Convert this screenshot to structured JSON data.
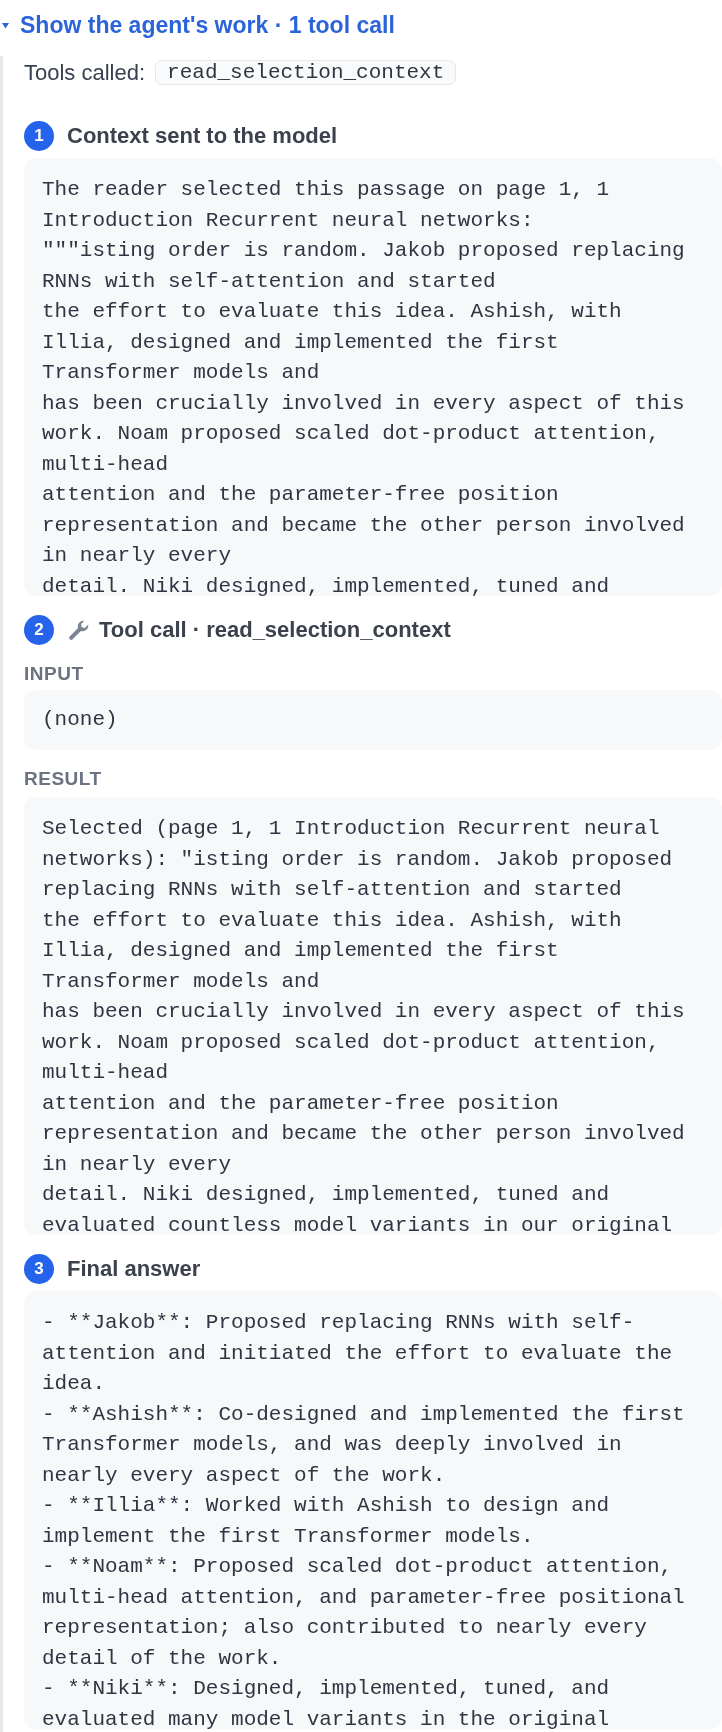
{
  "disclosure": {
    "label": "Show the agent's work · 1 tool call",
    "expanded": true
  },
  "tools_called": {
    "label": "Tools called:",
    "tools": [
      "read_selection_context"
    ]
  },
  "steps": [
    {
      "number": "1",
      "kind": "text",
      "title": "Context sent to the model",
      "text": "The reader selected this passage on page 1, 1\nIntroduction Recurrent neural networks:\n\"\"\"isting order is random. Jakob proposed replacing\nRNNs with self-attention and started\nthe effort to evaluate this idea. Ashish, with\nIllia, designed and implemented the first\nTransformer models and\nhas been crucially involved in every aspect of this\nwork. Noam proposed scaled dot-product attention,\nmulti-head\nattention and the parameter-free position\nrepresentation and became the other person involved\nin nearly every\ndetail. Niki designed, implemented, tuned and"
    },
    {
      "number": "2",
      "kind": "tool",
      "title": "Tool call · **read_selection_context**",
      "sections": [
        {
          "label": "INPUT",
          "text": "(none)"
        },
        {
          "label": "RESULT",
          "text": "Selected (page 1, 1 Introduction Recurrent neural\nnetworks): \"isting order is random. Jakob proposed\nreplacing RNNs with self-attention and started\nthe effort to evaluate this idea. Ashish, with\nIllia, designed and implemented the first\nTransformer models and\nhas been crucially involved in every aspect of this\nwork. Noam proposed scaled dot-product attention,\nmulti-head\nattention and the parameter-free position\nrepresentation and became the other person involved\nin nearly every\ndetail. Niki designed, implemented, tuned and\nevaluated countless model variants in our original"
        }
      ]
    },
    {
      "number": "3",
      "kind": "text",
      "title": "Final answer",
      "text": "- **Jakob**: Proposed replacing RNNs with self-\nattention and initiated the effort to evaluate the\nidea.\n- **Ashish**: Co-designed and implemented the first\nTransformer models, and was deeply involved in\nnearly every aspect of the work.\n- **Illia**: Worked with Ashish to design and\nimplement the first Transformer models.\n- **Noam**: Proposed scaled dot-product attention,\nmulti-head attention, and parameter-free positional\nrepresentation; also contributed to nearly every\ndetail of the work.\n- **Niki**: Designed, implemented, tuned, and\nevaluated many model variants in the original"
    }
  ]
}
